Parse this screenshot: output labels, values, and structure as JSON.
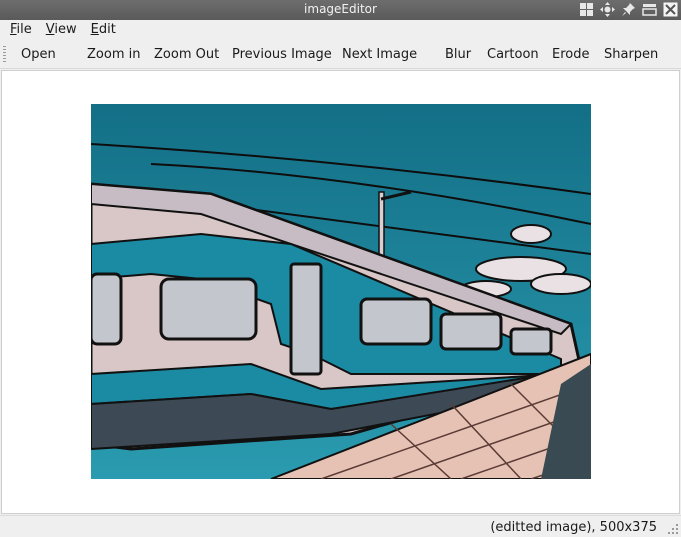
{
  "window": {
    "title": "imageEditor"
  },
  "menubar": [
    {
      "mnemonic": "F",
      "rest": "ile"
    },
    {
      "mnemonic": "V",
      "rest": "iew"
    },
    {
      "mnemonic": "E",
      "rest": "dit"
    }
  ],
  "toolbar": {
    "open": "Open",
    "zoom_in": "Zoom in",
    "zoom_out": "Zoom Out",
    "previous_image": "Previous Image",
    "next_image": "Next Image",
    "blur": "Blur",
    "cartoon": "Cartoon",
    "erode": "Erode",
    "sharpen": "Sharpen"
  },
  "statusbar": {
    "text": "(editted image), 500x375"
  },
  "icons": {
    "titlebar": [
      "grid-icon",
      "move-icon",
      "pin-icon",
      "shade-icon",
      "close-icon"
    ]
  },
  "colors": {
    "titlebar": "#5f5f5f",
    "sky": "#1d7f93",
    "train_body": "#d9c6c6",
    "train_stripe": "#1b8aa3",
    "outline": "#111111",
    "platform": "#e6c2b4"
  }
}
